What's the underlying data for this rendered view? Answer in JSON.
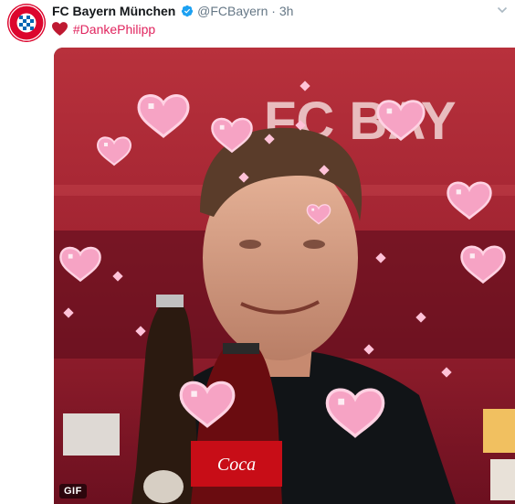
{
  "tweet": {
    "author_name": "FC Bayern München",
    "handle": "@FCBayern",
    "separator": "·",
    "time": "3h",
    "hashtag": "#DankePhilipp",
    "verified": true
  },
  "avatar": {
    "text": "FC BAYERN MÜNCHEN",
    "icon": "fc-bayern-crest-icon"
  },
  "media": {
    "type": "gif",
    "badge": "GIF",
    "backdrop_text": "FC BAY",
    "overlay_icon": "pink-pixel-hearts"
  },
  "colors": {
    "brand_red": "#dc052d",
    "hashtag": "#e0245e",
    "verified": "#1da1f2",
    "muted": "#657786"
  }
}
